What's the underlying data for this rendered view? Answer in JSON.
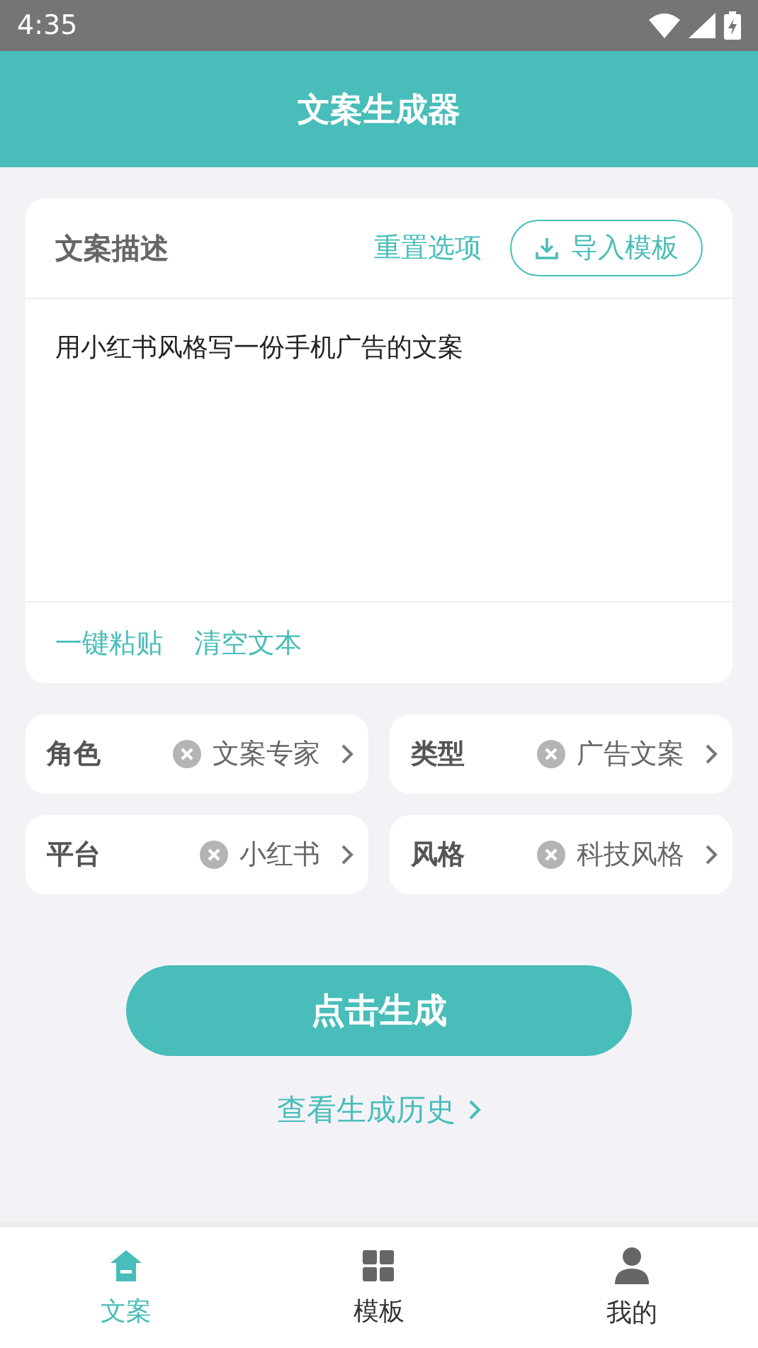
{
  "status_bar": {
    "time": "4:35"
  },
  "header": {
    "title": "文案生成器"
  },
  "description": {
    "title": "文案描述",
    "reset_link": "重置选项",
    "import_button": "导入模板",
    "value": "用小红书风格写一份手机广告的文案",
    "paste_link": "一键粘贴",
    "clear_link": "清空文本"
  },
  "options": [
    {
      "label": "角色",
      "value": "文案专家"
    },
    {
      "label": "类型",
      "value": "广告文案"
    },
    {
      "label": "平台",
      "value": "小红书"
    },
    {
      "label": "风格",
      "value": "科技风格"
    }
  ],
  "generate_button": "点击生成",
  "history_link": "查看生成历史",
  "bottom_nav": [
    {
      "label": "文案",
      "selected": true
    },
    {
      "label": "模板",
      "selected": false
    },
    {
      "label": "我的",
      "selected": false
    }
  ]
}
